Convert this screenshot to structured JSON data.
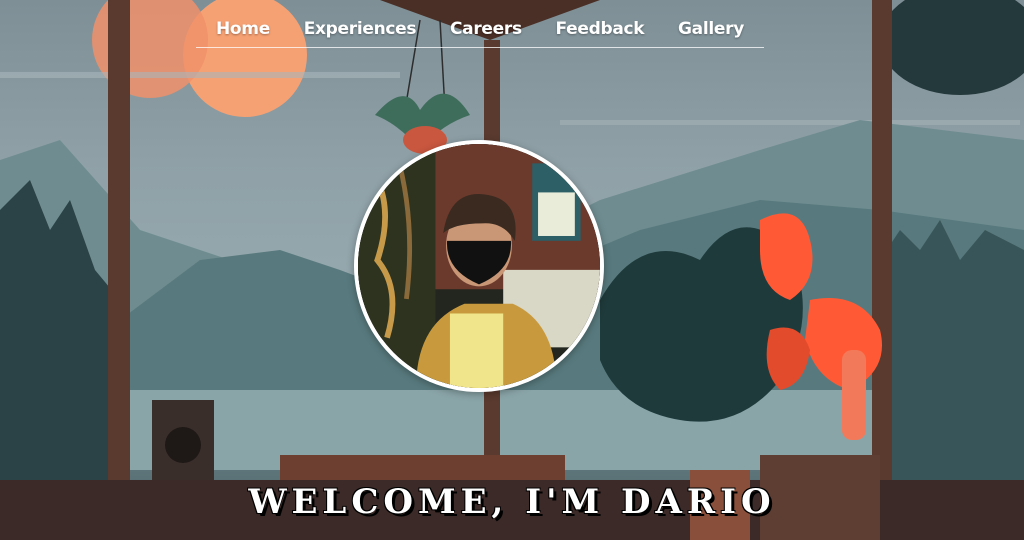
{
  "nav": {
    "items": [
      {
        "label": "Home"
      },
      {
        "label": "Experiences"
      },
      {
        "label": "Careers"
      },
      {
        "label": "Feedback"
      },
      {
        "label": "Gallery"
      }
    ]
  },
  "hero": {
    "headline": "WELCOME, I'M DARIO"
  },
  "colors": {
    "sky": "#8fa1a7",
    "sun": "#f49a68",
    "frame": "#5a3a2e",
    "accent_leaf": "#ff5a35",
    "text": "#ffffff"
  }
}
